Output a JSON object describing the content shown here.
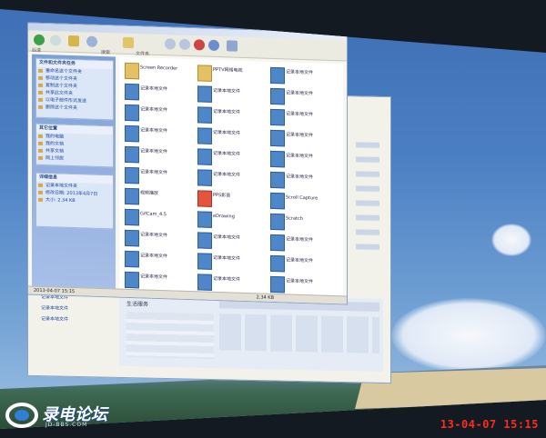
{
  "toolbar": {
    "back_label": "后退",
    "search_label": "搜索",
    "folders_label": "文件夹"
  },
  "task_pane": {
    "sections": [
      {
        "title": "文件和文件夹任务",
        "items": [
          "重命名这个文件夹",
          "移动这个文件夹",
          "复制这个文件夹",
          "共享此文件夹",
          "以电子邮件形式发送",
          "删除这个文件夹"
        ]
      },
      {
        "title": "其它位置",
        "items": [
          "我的电脑",
          "我的文档",
          "共享文档",
          "网上邻居"
        ]
      },
      {
        "title": "详细信息",
        "items": [
          "记录本地文件夹",
          "修改日期: 2013年4月7日",
          "大小: 2.34 KB"
        ]
      }
    ]
  },
  "files": [
    {
      "name": "Screen Recorder",
      "icon": "folder"
    },
    {
      "name": "PPTV网络电视",
      "icon": "folder"
    },
    {
      "name": "记录本地文件",
      "icon": "blue"
    },
    {
      "name": "记录本地文件",
      "icon": "blue"
    },
    {
      "name": "记录本地文件",
      "icon": "blue"
    },
    {
      "name": "记录本地文件",
      "icon": "blue"
    },
    {
      "name": "记录本地文件",
      "icon": "blue"
    },
    {
      "name": "记录本地文件",
      "icon": "blue"
    },
    {
      "name": "记录本地文件",
      "icon": "blue"
    },
    {
      "name": "记录本地文件",
      "icon": "blue"
    },
    {
      "name": "记录本地文件",
      "icon": "blue"
    },
    {
      "name": "记录本地文件",
      "icon": "blue"
    },
    {
      "name": "记录本地文件",
      "icon": "blue"
    },
    {
      "name": "记录本地文件",
      "icon": "blue"
    },
    {
      "name": "记录本地文件",
      "icon": "blue"
    },
    {
      "name": "记录本地文件",
      "icon": "blue"
    },
    {
      "name": "记录本地文件",
      "icon": "blue"
    },
    {
      "name": "记录本地文件",
      "icon": "blue"
    },
    {
      "name": "视频播放",
      "icon": "blue"
    },
    {
      "name": "PPS影音",
      "icon": "red"
    },
    {
      "name": "Scroll Capture",
      "icon": "blue"
    },
    {
      "name": "GifCam_4.5",
      "icon": "blue"
    },
    {
      "name": "eDrawing",
      "icon": "blue"
    },
    {
      "name": "Scratch",
      "icon": "blue"
    },
    {
      "name": "记录本地文件",
      "icon": "blue"
    },
    {
      "name": "记录本地文件",
      "icon": "blue"
    },
    {
      "name": "记录本地文件",
      "icon": "blue"
    },
    {
      "name": "记录本地文件",
      "icon": "blue"
    },
    {
      "name": "记录本地文件",
      "icon": "blue"
    },
    {
      "name": "记录本地文件",
      "icon": "blue"
    },
    {
      "name": "记录本地文件",
      "icon": "blue"
    },
    {
      "name": "记录本地文件",
      "icon": "blue"
    },
    {
      "name": "记录本地文件",
      "icon": "blue"
    }
  ],
  "status_bar": {
    "left": "2013-04-07 15:15",
    "right": "2.34 KB"
  },
  "back_window": {
    "items": [
      "记录本地文件",
      "记录本地文件",
      "记录本地文件"
    ],
    "panel_title": "生活服务"
  },
  "watermark": {
    "logo_text": "录电论坛",
    "sub_text": "JD-BBS.COM"
  },
  "timestamp": "13-04-07 15:15"
}
